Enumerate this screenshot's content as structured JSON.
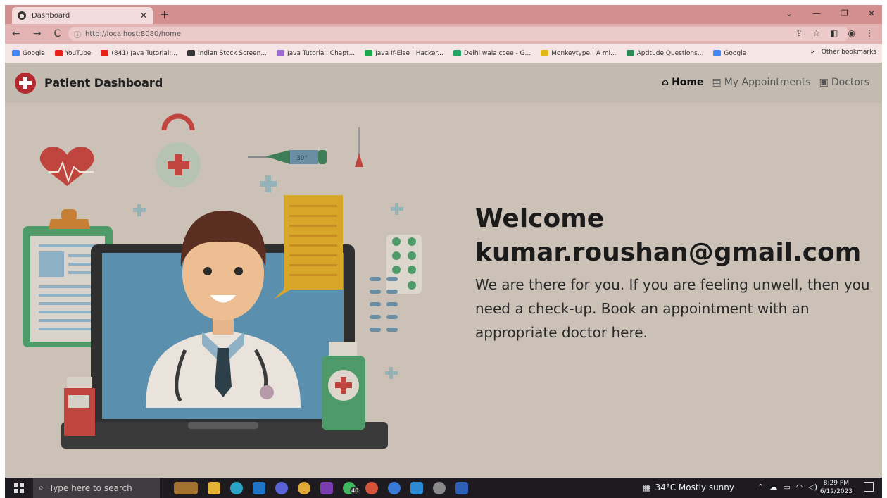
{
  "browser": {
    "tab_title": "Dashboard",
    "url": "http://localhost:8080/home",
    "bookmarks": [
      {
        "label": "Google",
        "color": "#4285f4"
      },
      {
        "label": "YouTube",
        "color": "#e62117"
      },
      {
        "label": "(841) Java Tutorial:...",
        "color": "#e62117"
      },
      {
        "label": "Indian Stock Screen...",
        "color": "#333333"
      },
      {
        "label": "Java Tutorial: Chapt...",
        "color": "#9c6bd6"
      },
      {
        "label": "Java If-Else | Hacker...",
        "color": "#1ba94c"
      },
      {
        "label": "Delhi wala ccee - G...",
        "color": "#1fa463"
      },
      {
        "label": "Monkeytype | A mi...",
        "color": "#e2b714"
      },
      {
        "label": "Aptitude Questions...",
        "color": "#2e8b57"
      },
      {
        "label": "Google",
        "color": "#4285f4"
      }
    ],
    "other_bookmarks": "Other bookmarks",
    "more_bookmarks": "»"
  },
  "app": {
    "brand": "Patient Dashboard",
    "nav": [
      {
        "label": "Home",
        "icon": "home-icon",
        "active": true
      },
      {
        "label": "My Appointments",
        "icon": "clipboard-icon",
        "active": false
      },
      {
        "label": "Doctors",
        "icon": "hospital-icon",
        "active": false
      }
    ],
    "welcome_title": "Welcome",
    "user_email": "kumar.roushan@gmail.com",
    "message": "We are there for you. If you are feeling unwell, then you need a check-up. Book an appointment with an appropriate doctor here.",
    "thermometer_reading": "39°"
  },
  "taskbar": {
    "search_placeholder": "Type here to search",
    "weather": "34°C  Mostly sunny",
    "time": "8:29 PM",
    "date": "6/12/2023",
    "whatsapp_badge": "40"
  },
  "colors": {
    "accent": "#b2292e",
    "page_bg": "#cbc1b7",
    "tabbar": "#d38e8e"
  }
}
